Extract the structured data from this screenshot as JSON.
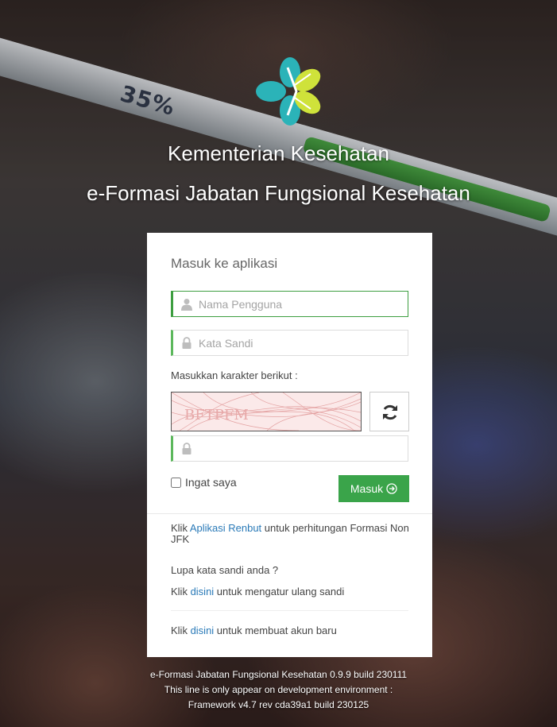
{
  "header": {
    "ministry": "Kementerian Kesehatan",
    "app_name": "e-Formasi Jabatan Fungsional Kesehatan"
  },
  "login": {
    "title": "Masuk ke aplikasi",
    "username_placeholder": "Nama Pengguna",
    "password_placeholder": "Kata Sandi",
    "captcha_label": "Masukkan karakter berikut :",
    "captcha_text": "BFTPFM",
    "remember_label": "Ingat saya",
    "submit_label": "Masuk"
  },
  "links": {
    "renbut_prefix": "Klik ",
    "renbut_link": "Aplikasi Renbut",
    "renbut_suffix": " untuk perhitungan Formasi Non JFK",
    "forgot_question": "Lupa kata sandi anda ?",
    "reset_prefix": "Klik ",
    "reset_link": "disini",
    "reset_suffix": " untuk mengatur ulang sandi",
    "register_prefix": "Klik ",
    "register_link": "disini",
    "register_suffix": " untuk membuat akun baru"
  },
  "footer": {
    "line1": "e-Formasi Jabatan Fungsional Kesehatan 0.9.9 build 230111",
    "line2": "This line is only appear on development environment :",
    "line3": "Framework v4.7 rev cda39a1 build 230125"
  },
  "background": {
    "syringe_label": "35%"
  },
  "icons": {
    "logo": "kemenkes-logo",
    "user": "user-icon",
    "lock": "lock-icon",
    "refresh": "refresh-icon",
    "submit": "arrow-right-circle-icon"
  },
  "colors": {
    "accent": "#3aa44a",
    "link": "#2a7ab8",
    "logo_teal": "#2bb3b8",
    "logo_lime": "#cfe23a"
  }
}
